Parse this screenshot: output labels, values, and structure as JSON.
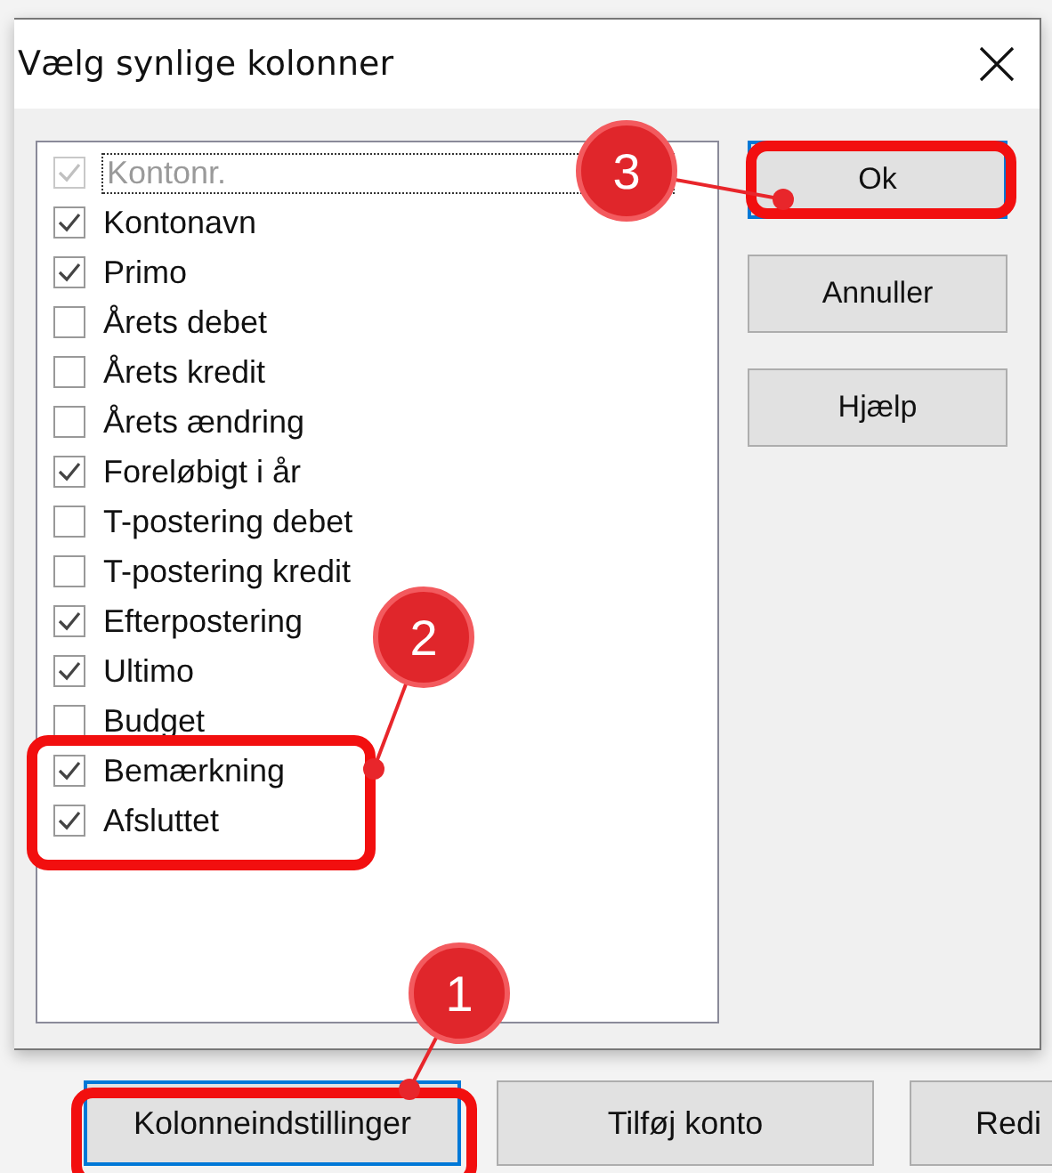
{
  "dialog": {
    "title": "Vælg synlige kolonner",
    "columns": [
      {
        "label": "Kontonr.",
        "checked": true,
        "disabled": true,
        "focused": true
      },
      {
        "label": "Kontonavn",
        "checked": true,
        "disabled": false,
        "focused": false
      },
      {
        "label": "Primo",
        "checked": true,
        "disabled": false,
        "focused": false
      },
      {
        "label": "Årets debet",
        "checked": false,
        "disabled": false,
        "focused": false
      },
      {
        "label": "Årets kredit",
        "checked": false,
        "disabled": false,
        "focused": false
      },
      {
        "label": "Årets ændring",
        "checked": false,
        "disabled": false,
        "focused": false
      },
      {
        "label": "Foreløbigt i år",
        "checked": true,
        "disabled": false,
        "focused": false
      },
      {
        "label": "T-postering debet",
        "checked": false,
        "disabled": false,
        "focused": false
      },
      {
        "label": "T-postering kredit",
        "checked": false,
        "disabled": false,
        "focused": false
      },
      {
        "label": "Efterpostering",
        "checked": true,
        "disabled": false,
        "focused": false
      },
      {
        "label": "Ultimo",
        "checked": true,
        "disabled": false,
        "focused": false
      },
      {
        "label": "Budget",
        "checked": false,
        "disabled": false,
        "focused": false
      },
      {
        "label": "Bemærkning",
        "checked": true,
        "disabled": false,
        "focused": false
      },
      {
        "label": "Afsluttet",
        "checked": true,
        "disabled": false,
        "focused": false
      }
    ],
    "buttons": [
      {
        "label": "Ok",
        "default": true
      },
      {
        "label": "Annuller",
        "default": false
      },
      {
        "label": "Hjælp",
        "default": false
      }
    ]
  },
  "toolbar": {
    "buttons": [
      {
        "label": "Kolonneindstillinger",
        "default": true
      },
      {
        "label": "Tilføj konto",
        "default": false
      },
      {
        "label": "Redi",
        "default": false
      }
    ]
  },
  "callouts": [
    {
      "number": "3"
    },
    {
      "number": "2"
    },
    {
      "number": "1"
    }
  ]
}
